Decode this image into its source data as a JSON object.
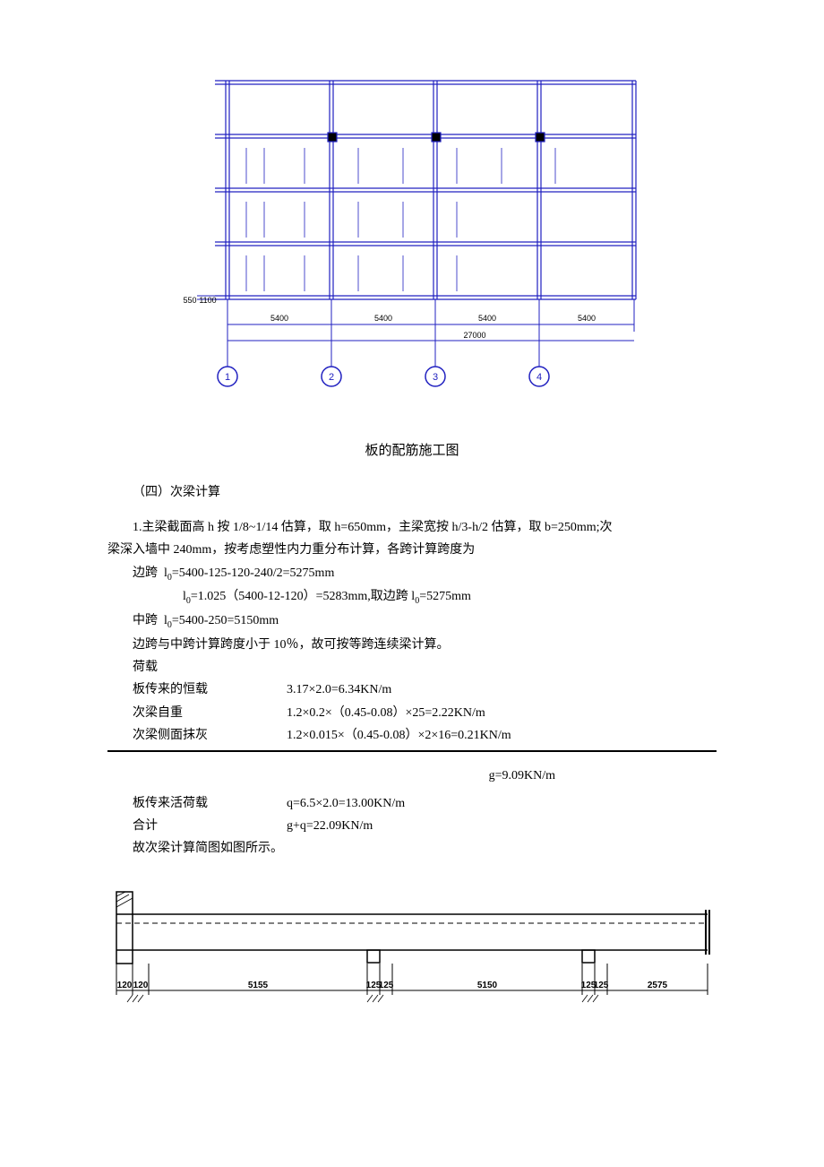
{
  "figures": {
    "plan": {
      "span_labels": [
        "5400",
        "5400",
        "5400",
        "5400"
      ],
      "total_width": "27000",
      "axis_labels": [
        "1",
        "2",
        "3",
        "4"
      ],
      "left_dims": [
        "550",
        "1100"
      ]
    },
    "beam": {
      "dims": [
        "120",
        "120",
        "5155",
        "125",
        "125",
        "5150",
        "125",
        "125",
        "2575"
      ]
    }
  },
  "caption1": "板的配筋施工图",
  "section4_title": "（四）次梁计算",
  "line1_a": "1.主梁截面高 h 按 1/8~1/14 估算，取 h=650mm，主梁宽按 h/3-h/2 估算，取 b=250mm;次",
  "line1_b": "梁深入墙中 240mm，按考虑塑性内力重分布计算，各跨计算跨度为",
  "line2_label": "边跨",
  "line2_eq": "l",
  "line2_sub": "0",
  "line2_rest": "=5400-125-120-240/2=5275mm",
  "line3_eq": "l",
  "line3_sub": "0",
  "line3_rest": "=1.025（5400-12-120）=5283mm,取边跨 l",
  "line3_sub2": "0",
  "line3_rest2": "=5275mm",
  "line4_label": "中跨",
  "line4_eq": "l",
  "line4_sub": "0",
  "line4_rest": "=5400-250=5150mm",
  "line5": "边跨与中跨计算跨度小于 10％，故可按等跨连续梁计算。",
  "line6": "荷载",
  "loads": [
    {
      "label": "板传来的恒载",
      "value": "3.17×2.0=6.34KN/m"
    },
    {
      "label": "次梁自重",
      "value": "1.2×0.2×（0.45-0.08）×25=2.22KN/m"
    },
    {
      "label": "次梁侧面抹灰",
      "value": "1.2×0.015×（0.45-0.08）×2×16=0.21KN/m"
    }
  ],
  "g_value": "g=9.09KN/m",
  "loads2": [
    {
      "label": "板传来活荷载",
      "value": "q=6.5×2.0=13.00KN/m"
    },
    {
      "label": "合计",
      "value": "g+q=22.09KN/m"
    }
  ],
  "line_final": "故次梁计算简图如图所示。"
}
